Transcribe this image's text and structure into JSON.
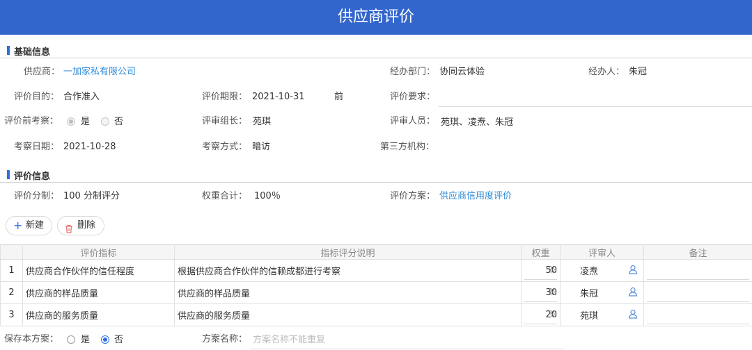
{
  "title": "供应商评价",
  "sections": {
    "basic": "基础信息",
    "eval": "评价信息"
  },
  "basic": {
    "supplier_label": "供应商：",
    "supplier_value": "一加家私有限公司",
    "dept_label": "经办部门：",
    "dept_value": "协同云体验",
    "handler_label": "经办人：",
    "handler_value": "朱冠",
    "purpose_label": "评价目的：",
    "purpose_value": "合作准入",
    "deadline_label": "评价期限：",
    "deadline_value": "2021-10-31",
    "deadline_suffix": "前",
    "requirement_label": "评价要求：",
    "precheck_label": "评价前考察：",
    "precheck_yes": "是",
    "precheck_no": "否",
    "leader_label": "评审组长：",
    "leader_value": "苑琪",
    "members_label": "评审人员：",
    "members_value": "苑琪、凌焘、朱冠",
    "checkdate_label": "考察日期：",
    "checkdate_value": "2021-10-28",
    "checkmethod_label": "考察方式：",
    "checkmethod_value": "暗访",
    "thirdparty_label": "第三方机构："
  },
  "eval": {
    "score_label": "评价分制：",
    "score_value": "100 分制评分",
    "weight_label": "权重合计：",
    "weight_value": "100％",
    "plan_label": "评价方案：",
    "plan_value": "供应商信用度评价"
  },
  "toolbar": {
    "new_label": "新建",
    "delete_label": "删除"
  },
  "table": {
    "headers": [
      "",
      "评价指标",
      "指标评分说明",
      "权重",
      "评审人",
      "备注"
    ],
    "rows": [
      {
        "no": "1",
        "indicator": "供应商合作伙伴的信任程度",
        "desc": "根据供应商合作伙伴的信赖成都进行考察",
        "weight": "50",
        "pct": "%",
        "reviewer": "凌焘"
      },
      {
        "no": "2",
        "indicator": "供应商的样品质量",
        "desc": "供应商的样品质量",
        "weight": "30",
        "pct": "%",
        "reviewer": "朱冠"
      },
      {
        "no": "3",
        "indicator": "供应商的服务质量",
        "desc": "供应商的服务质量",
        "weight": "20",
        "pct": "%",
        "reviewer": "苑琪"
      }
    ]
  },
  "footer": {
    "save_label": "保存本方案：",
    "save_yes": "是",
    "save_no": "否",
    "plan_name_label": "方案名称：",
    "plan_name_placeholder": "方案名称不能重复"
  }
}
